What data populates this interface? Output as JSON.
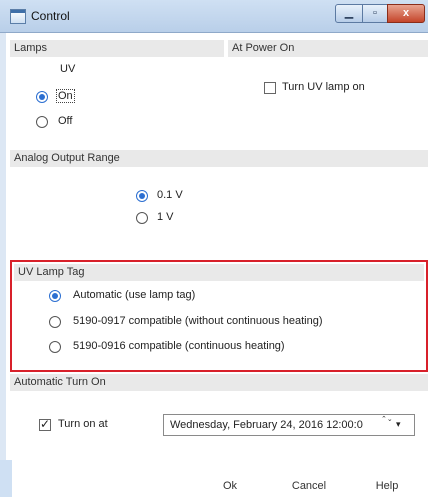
{
  "window": {
    "title": "Control",
    "min_glyph": "▁",
    "max_glyph": "▫",
    "close_glyph": "x"
  },
  "lamps": {
    "header": "Lamps",
    "column": "UV",
    "options": [
      {
        "label": "On",
        "selected": true
      },
      {
        "label": "Off",
        "selected": false
      }
    ]
  },
  "power_on": {
    "header": "At Power On",
    "checkbox_label": "Turn UV lamp on",
    "checked": false
  },
  "analog": {
    "header": "Analog Output Range",
    "options": [
      {
        "label": "0.1 V",
        "selected": true
      },
      {
        "label": "1 V",
        "selected": false
      }
    ]
  },
  "uv_lamp_tag": {
    "header": "UV Lamp Tag",
    "highlight_color": "#d8202a",
    "options": [
      {
        "label": "Automatic (use lamp tag)",
        "selected": true
      },
      {
        "label": "5190-0917 compatible (without continuous heating)",
        "selected": false
      },
      {
        "label": "5190-0916 compatible (continuous heating)",
        "selected": false
      }
    ]
  },
  "auto_turn_on": {
    "header": "Automatic Turn On",
    "checkbox_label": "Turn on at",
    "checked": true,
    "datetime": "Wednesday, February 24, 2016  12:00:0",
    "spin_glyph": "⌃⌄",
    "dropdown_glyph": "▾"
  },
  "buttons": {
    "ok": "Ok",
    "cancel": "Cancel",
    "help": "Help"
  }
}
